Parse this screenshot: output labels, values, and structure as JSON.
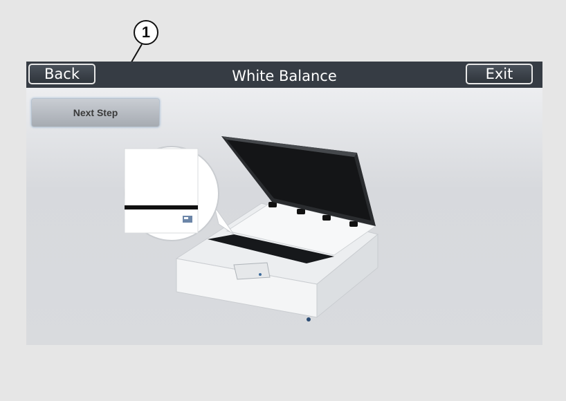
{
  "callout": {
    "number": "1"
  },
  "titlebar": {
    "back_label": "Back",
    "title": "White Balance",
    "exit_label": "Exit"
  },
  "actions": {
    "next_step_label": "Next Step"
  },
  "illustration": {
    "subject": "flatbed-scanner",
    "detail": "magnified-calibration-sheet-corner"
  }
}
